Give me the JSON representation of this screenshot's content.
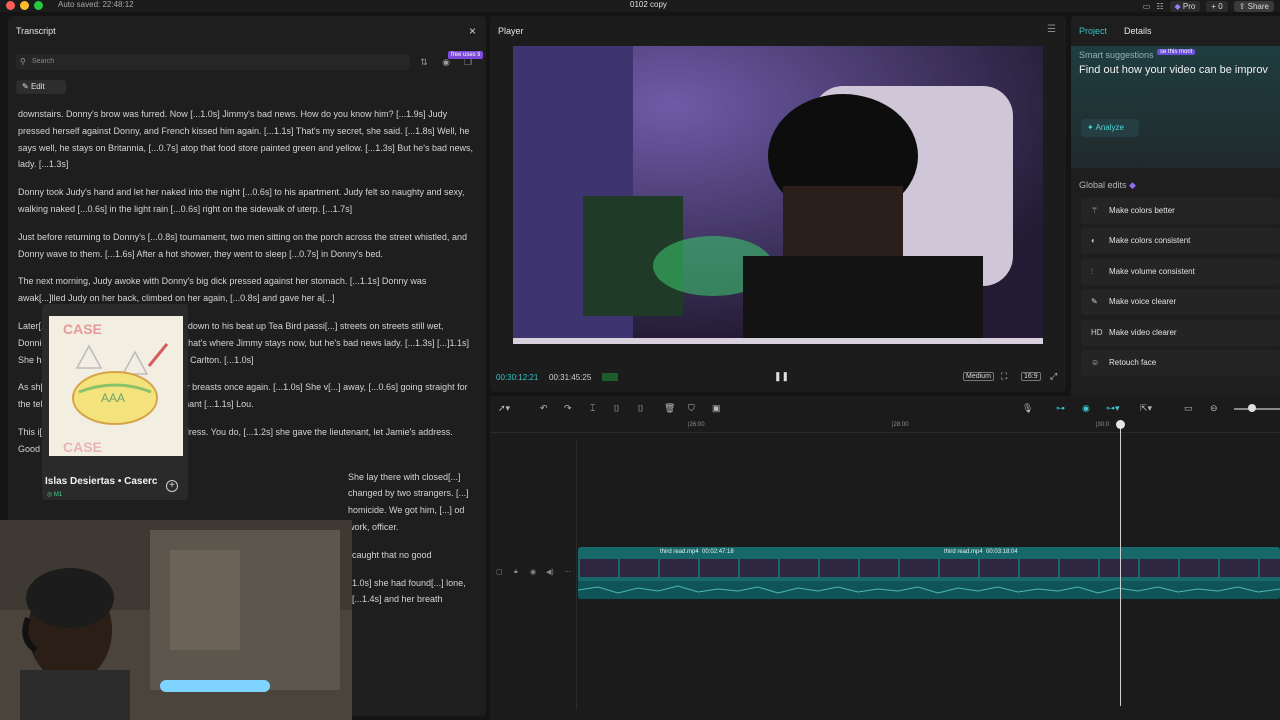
{
  "titlebar": {
    "autosaved": "Auto saved: 22:48:12",
    "doc_title": "0102 copy",
    "pro_label": "Pro",
    "count_label": "0",
    "share_label": "Share"
  },
  "transcript": {
    "title": "Transcript",
    "search_placeholder": "Search",
    "free_badge": "free uses ti",
    "edit_label": "Edit",
    "paragraphs": [
      "downstairs. Donny's brow was furred. Now [...1.0s] Jimmy's bad news. How do you know him? [...1.9s] Judy pressed herself against Donny, and French kissed him again. [...1.1s] That's my secret, she said. [...1.8s] Well, he says well, he stays on Britannia, [...0.7s] atop that food store painted green and yellow. [...1.3s] But he's bad news, lady. [...1.3s]",
      "Donny took Judy's hand and let her naked into the night [...0.6s] to his apartment. Judy felt so naughty and sexy, walking naked [...0.6s] in the light rain [...0.6s] right on the sidewalk of uterp. [...1.7s]",
      "Just before returning to Donny's [...0.8s] tournament, two men sitting on the porch across the street whistled, and Donny wave to them. [...1.6s] After a hot shower, they went to sleep [...0.7s] in Donny's bed.",
      "The next morning, Judy awoke with Donny's big dick pressed against her stomach. [...1.1s] Donny was awak[...]lled Judy on her back, climbed on her again, [...0.8s] and gave her a[...]",
      "Later[...] a T-shirt after, [...1.1s] and let her down to his beat up Tea Bird passi[...] streets on streets still wet, Donnie pointed to a wooden build[...]said, that's where Jimmy stays now, but he's bad news lady. [...1.3s] [...]1.1s] She had him [...1.4s] let her out on [...1.6s] Carlton. [...1.0s]",
      "As sh[...]ched over and [...0.8s] fondled her breasts once again. [...1.0s] She v[...] away, [...0.6s] going straight for the telephone. Judy called homi[...]r lieutenant [...1.1s] Lou.",
      "This i[...] patrol. I have Jimmy Walker's address. You do, [...1.2s] she gave the lieutenant, let Jamie's address. Good work. I'll let you know if we get him.",
      "She lay there with closed[...] changed by two strangers. [...] homicide. We got him, [...] od work, officer.",
      "caught that no good",
      "1.0s] she had found[...] lone, [...1.4s] and her breath"
    ]
  },
  "album": {
    "title": "Islas Desiertas • Caserc",
    "subtitle": "M1"
  },
  "player": {
    "title": "Player",
    "time_current": "00:30:12:21",
    "time_total": "00:31:45:25",
    "quality": "Medium",
    "ratio": "16:9"
  },
  "right_panel": {
    "tab_project": "Project",
    "tab_details": "Details",
    "smart_label": "Smart suggestions",
    "smart_badge": "se this mont",
    "smart_headline": "Find out how your video can be improv",
    "analyze_label": "Analyze",
    "global_edits_label": "Global edits",
    "items": [
      {
        "icon": "wand-icon",
        "label": "Make colors better"
      },
      {
        "icon": "palette-icon",
        "label": "Make colors consistent"
      },
      {
        "icon": "sliders-icon",
        "label": "Make volume consistent"
      },
      {
        "icon": "mic-icon",
        "label": "Make voice clearer"
      },
      {
        "icon": "hd-icon",
        "label": "Make video clearer"
      },
      {
        "icon": "face-icon",
        "label": "Retouch face"
      }
    ]
  },
  "timeline": {
    "ruler": [
      "|26:00",
      "|28:00",
      "|30:0"
    ],
    "clip_labels": [
      {
        "name": "third read.mp4",
        "duration": "00:02:47:18"
      },
      {
        "name": "third read.mp4",
        "duration": "00:03:18:04"
      }
    ]
  },
  "colors": {
    "accent": "#35c3c8",
    "clip": "#17686a",
    "badge": "#7b4bdb"
  }
}
